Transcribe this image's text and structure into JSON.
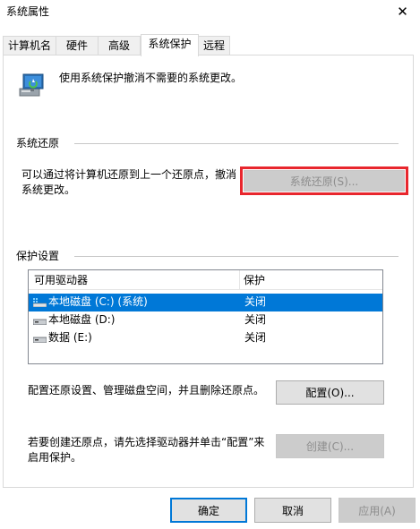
{
  "window": {
    "title": "系统属性",
    "close_glyph": "✕"
  },
  "tabs": [
    {
      "label": "计算机名"
    },
    {
      "label": "硬件"
    },
    {
      "label": "高级"
    },
    {
      "label": "系统保护",
      "active": true
    },
    {
      "label": "远程"
    }
  ],
  "intro": {
    "text": "使用系统保护撤消不需要的系统更改。"
  },
  "restore_section": {
    "heading": "系统还原",
    "description_line1": "可以通过将计算机还原到上一个还原点，撤消",
    "description_line2": "系统更改。",
    "button_label": "系统还原(S)..."
  },
  "protection_section": {
    "heading": "保护设置",
    "columns": [
      "可用驱动器",
      "保护"
    ],
    "drives": [
      {
        "name": "本地磁盘 (C:) (系统)",
        "protection": "关闭",
        "selected": true,
        "system": true
      },
      {
        "name": "本地磁盘 (D:)",
        "protection": "关闭",
        "selected": false,
        "system": false
      },
      {
        "name": "数据 (E:)",
        "protection": "关闭",
        "selected": false,
        "system": false
      }
    ],
    "configure_text": "配置还原设置、管理磁盘空间，并且删除还原点。",
    "configure_button": "配置(O)...",
    "create_text_line1": "若要创建还原点，请先选择驱动器并单击“配置”来",
    "create_text_line2": "启用保护。",
    "create_button": "创建(C)..."
  },
  "footer": {
    "ok": "确定",
    "cancel": "取消",
    "apply": "应用(A)"
  },
  "colors": {
    "accent": "#0078d7",
    "highlight_border": "#e8262d"
  }
}
